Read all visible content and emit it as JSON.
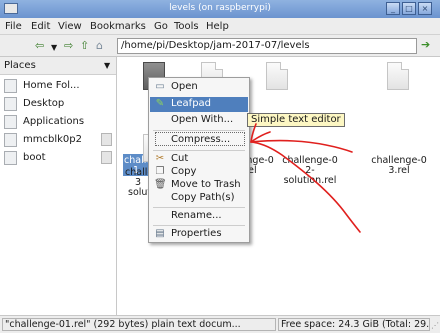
{
  "window": {
    "title": "levels (on raspberrypi)"
  },
  "menu": [
    "File",
    "Edit",
    "View",
    "Bookmarks",
    "Go",
    "Tools",
    "Help"
  ],
  "toolbar": {
    "path": "/home/pi/Desktop/jam-2017-07/levels"
  },
  "sidebar": {
    "header": "Places",
    "items": [
      {
        "label": "Home Fol...",
        "icon": "home-folder-icon"
      },
      {
        "label": "Desktop",
        "icon": "desktop-folder-icon"
      },
      {
        "label": "Applications",
        "icon": "applications-icon"
      },
      {
        "label": "mmcblk0p2",
        "icon": "drive-icon"
      },
      {
        "label": "boot",
        "icon": "drive-icon"
      }
    ]
  },
  "files": [
    {
      "line1": "challe",
      "line2": "1."
    },
    {
      "line1": "challenge-0",
      "line2": "2.rel"
    },
    {
      "line1": "challenge-0",
      "line2": "2-",
      "line3": "solution.rel"
    },
    {
      "line1": "challenge-0",
      "line2": "3.rel"
    },
    {
      "line1": "challe",
      "line2": "3",
      "line3": "soluti"
    }
  ],
  "context_menu": {
    "items": [
      "Open",
      "Leafpad",
      "Open With...",
      "Compress...",
      "Cut",
      "Copy",
      "Move to Trash",
      "Copy Path(s)",
      "Rename...",
      "Properties"
    ]
  },
  "tooltip": "Simple text editor",
  "status": {
    "selection": "\"challenge-01.rel\" (292 bytes) plain text docum...",
    "free_space": "Free space: 24.3 GiB (Total: 29.2 GiB)"
  },
  "colors": {
    "selection": "#4f7fbd",
    "annotation": "#e0201e",
    "tooltip_bg": "#fdf7c3"
  }
}
